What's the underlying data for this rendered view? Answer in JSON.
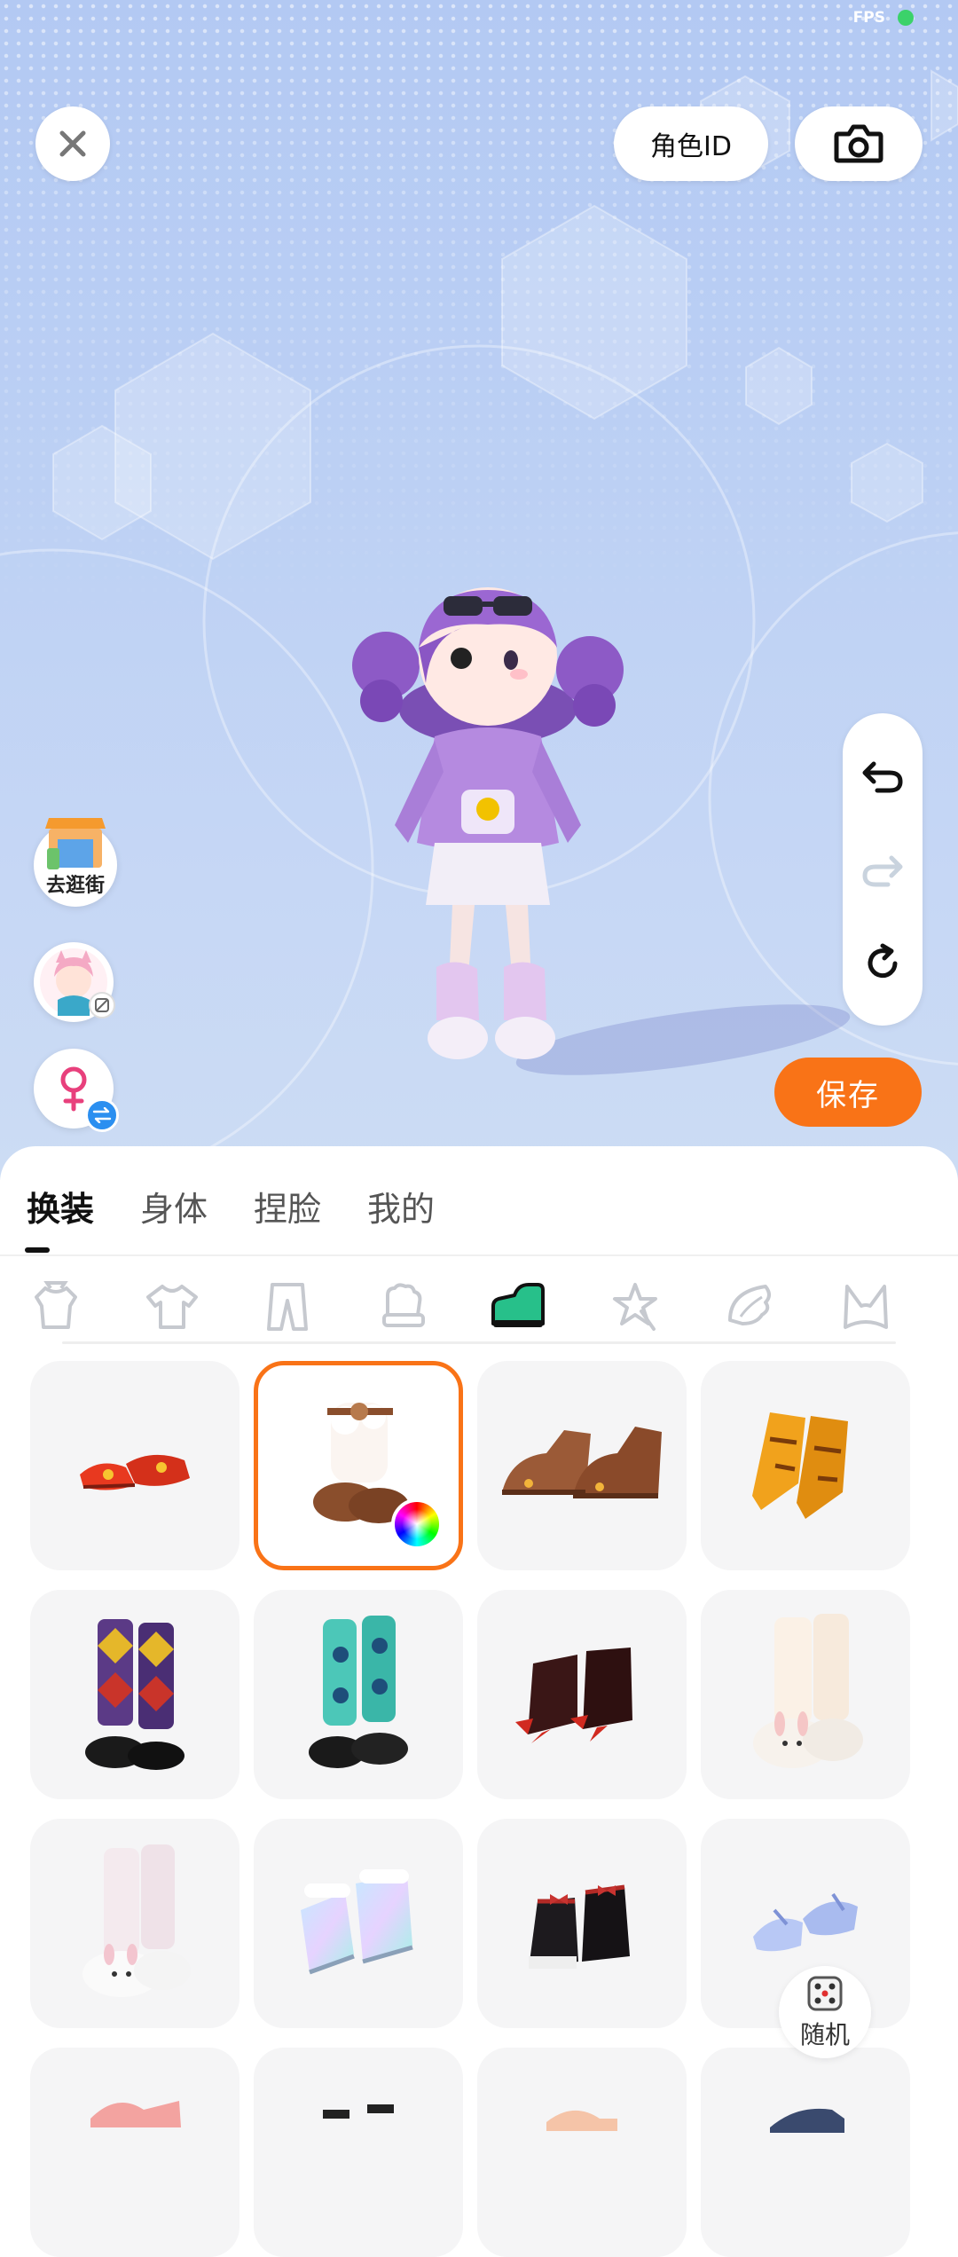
{
  "status_bar": {
    "fps_label": "FPS"
  },
  "top": {
    "role_id_label": "角色ID"
  },
  "side": {
    "shop_label": "去逛街"
  },
  "actions": {
    "save_label": "保存"
  },
  "tabs": [
    {
      "label": "换装",
      "active": true
    },
    {
      "label": "身体",
      "active": false
    },
    {
      "label": "捏脸",
      "active": false
    },
    {
      "label": "我的",
      "active": false
    }
  ],
  "categories": [
    {
      "icon": "outfit-icon"
    },
    {
      "icon": "top-icon"
    },
    {
      "icon": "pants-icon"
    },
    {
      "icon": "glove-icon"
    },
    {
      "icon": "shoe-icon",
      "active": true
    },
    {
      "icon": "accessory-star-icon"
    },
    {
      "icon": "wing-icon"
    },
    {
      "icon": "ears-icon"
    }
  ],
  "items": [
    {
      "name": "red-embroidered-shoes"
    },
    {
      "name": "fluffy-bear-boots",
      "selected": true,
      "colorable": true
    },
    {
      "name": "brown-paw-shoes"
    },
    {
      "name": "yellow-claw-boots"
    },
    {
      "name": "argyle-socks-shoes"
    },
    {
      "name": "teal-bear-socks-shoes"
    },
    {
      "name": "red-claw-boots"
    },
    {
      "name": "bunny-slippers-socks"
    },
    {
      "name": "white-bunny-slippers"
    },
    {
      "name": "holographic-boots"
    },
    {
      "name": "black-bow-boots"
    },
    {
      "name": "blue-ribbon-heels"
    }
  ],
  "random": {
    "label": "随机"
  },
  "colors": {
    "accent": "#f97317",
    "sky_top": "#b3c9f3",
    "card_bg": "#f5f5f6"
  }
}
